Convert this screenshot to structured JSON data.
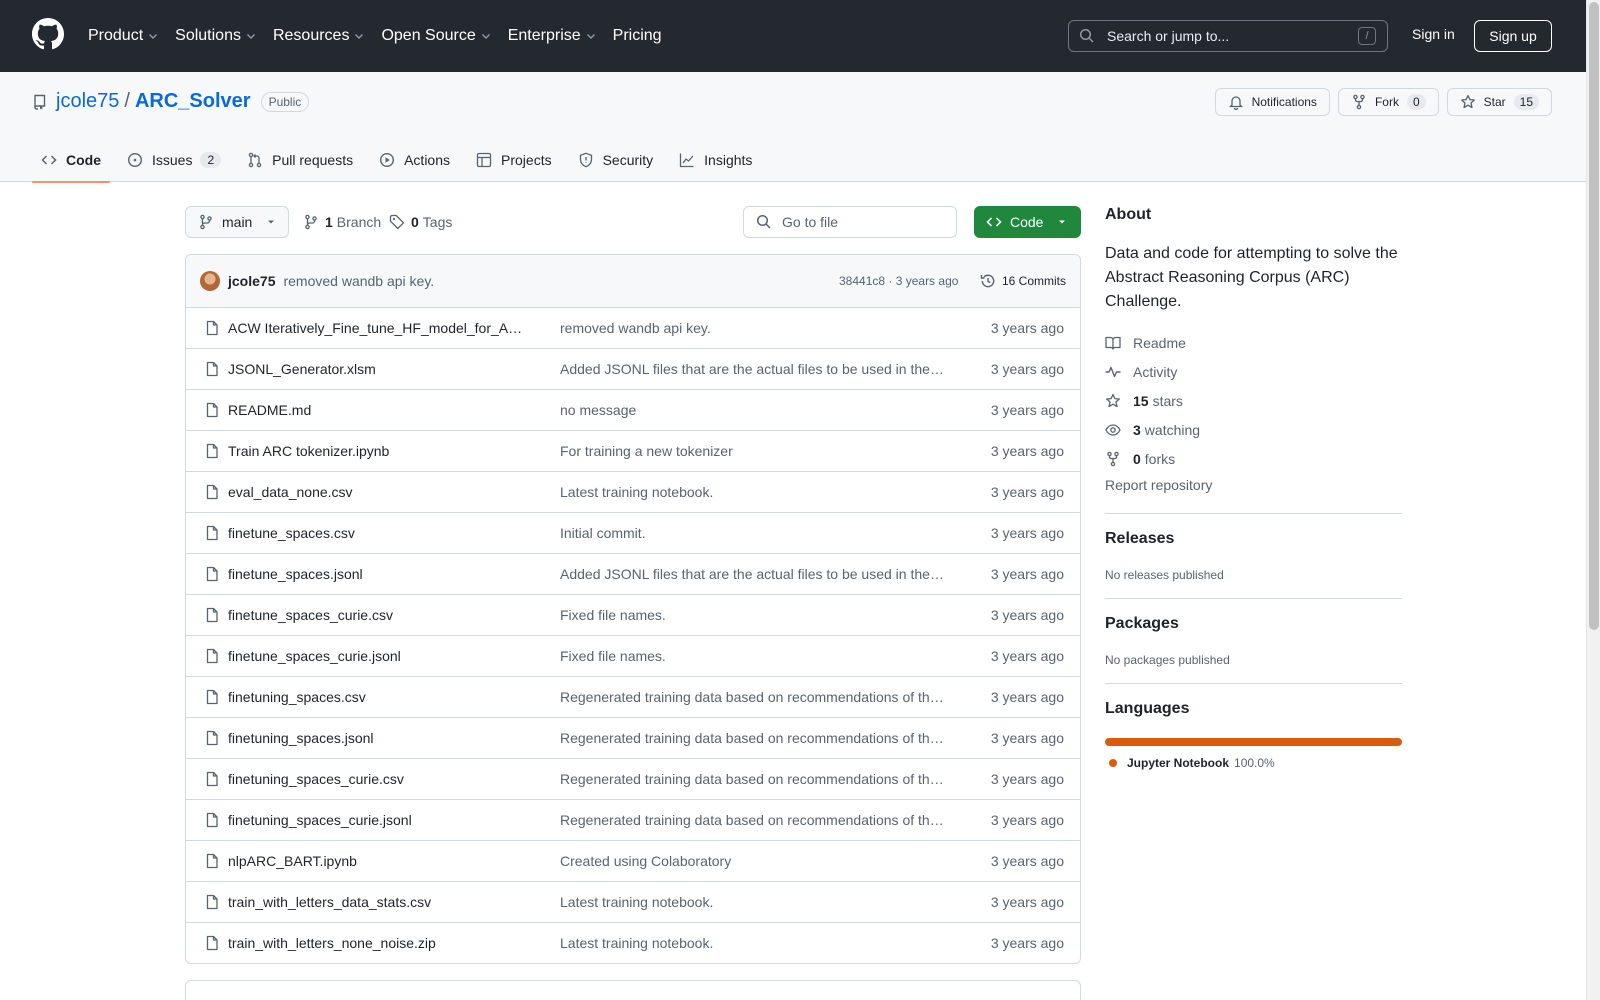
{
  "header": {
    "nav": [
      "Product",
      "Solutions",
      "Resources",
      "Open Source",
      "Enterprise",
      "Pricing"
    ],
    "search_placeholder": "Search or jump to...",
    "search_shortcut": "/",
    "sign_in": "Sign in",
    "sign_up": "Sign up"
  },
  "repo": {
    "owner": "jcole75",
    "separator": "/",
    "name": "ARC_Solver",
    "visibility": "Public",
    "actions": {
      "notifications": "Notifications",
      "fork": "Fork",
      "fork_count": "0",
      "star": "Star",
      "star_count": "15"
    },
    "tabs": [
      {
        "label": "Code",
        "icon": "code-icon"
      },
      {
        "label": "Issues",
        "icon": "issue-icon",
        "count": "2"
      },
      {
        "label": "Pull requests",
        "icon": "pull-request-icon"
      },
      {
        "label": "Actions",
        "icon": "play-icon"
      },
      {
        "label": "Projects",
        "icon": "table-icon"
      },
      {
        "label": "Security",
        "icon": "shield-icon"
      },
      {
        "label": "Insights",
        "icon": "graph-icon"
      }
    ]
  },
  "toolbar": {
    "branch": "main",
    "branch_count": "1",
    "branch_label": "Branch",
    "tag_count": "0",
    "tag_label": "Tags",
    "goto_placeholder": "Go to file",
    "code_button": "Code"
  },
  "latest_commit": {
    "author": "jcole75",
    "message": "removed wandb api key.",
    "sha_age": "38441c8 · 3 years ago",
    "commits": "16 Commits"
  },
  "files": [
    {
      "name": "ACW Iteratively_Fine_tune_HF_model_for_ARC.ipynb",
      "message": "removed wandb api key.",
      "age": "3 years ago"
    },
    {
      "name": "JSONL_Generator.xlsm",
      "message": "Added JSONL files that are the actual files to be used in the finetuning",
      "age": "3 years ago"
    },
    {
      "name": "README.md",
      "message": "no message",
      "age": "3 years ago"
    },
    {
      "name": "Train ARC tokenizer.ipynb",
      "message": "For training a new tokenizer",
      "age": "3 years ago"
    },
    {
      "name": "eval_data_none.csv",
      "message": "Latest training notebook.",
      "age": "3 years ago"
    },
    {
      "name": "finetune_spaces.csv",
      "message": "Initial commit.",
      "age": "3 years ago"
    },
    {
      "name": "finetune_spaces.jsonl",
      "message": "Added JSONL files that are the actual files to be used in the finetuning",
      "age": "3 years ago"
    },
    {
      "name": "finetune_spaces_curie.csv",
      "message": "Fixed file names.",
      "age": "3 years ago"
    },
    {
      "name": "finetune_spaces_curie.jsonl",
      "message": "Fixed file names.",
      "age": "3 years ago"
    },
    {
      "name": "finetuning_spaces.csv",
      "message": "Regenerated training data based on recommendations of the OpenAI tool",
      "age": "3 years ago"
    },
    {
      "name": "finetuning_spaces.jsonl",
      "message": "Regenerated training data based on recommendations of the OpenAI tool",
      "age": "3 years ago"
    },
    {
      "name": "finetuning_spaces_curie.csv",
      "message": "Regenerated training data based on recommendations of the OpenAI tool",
      "age": "3 years ago"
    },
    {
      "name": "finetuning_spaces_curie.jsonl",
      "message": "Regenerated training data based on recommendations of the OpenAI tool",
      "age": "3 years ago"
    },
    {
      "name": "nlpARC_BART.ipynb",
      "message": "Created using Colaboratory",
      "age": "3 years ago"
    },
    {
      "name": "train_with_letters_data_stats.csv",
      "message": "Latest training notebook.",
      "age": "3 years ago"
    },
    {
      "name": "train_with_letters_none_noise.zip",
      "message": "Latest training notebook.",
      "age": "3 years ago"
    }
  ],
  "sidebar": {
    "about_title": "About",
    "description": "Data and code for attempting to solve the Abstract Reasoning Corpus (ARC) Challenge.",
    "readme": "Readme",
    "activity": "Activity",
    "stars_count": "15",
    "stars_label": "stars",
    "watching_count": "3",
    "watching_label": "watching",
    "forks_count": "0",
    "forks_label": "forks",
    "report": "Report repository",
    "releases_title": "Releases",
    "releases_empty": "No releases published",
    "packages_title": "Packages",
    "packages_empty": "No packages published",
    "languages_title": "Languages",
    "language_name": "Jupyter Notebook",
    "language_pct": "100.0%",
    "language_color": "#da5b0b"
  },
  "colors": {
    "header_bg": "#24292f",
    "link": "#0969da",
    "code_button": "#1f883d",
    "active_tab_underline": "#fd8c73"
  }
}
